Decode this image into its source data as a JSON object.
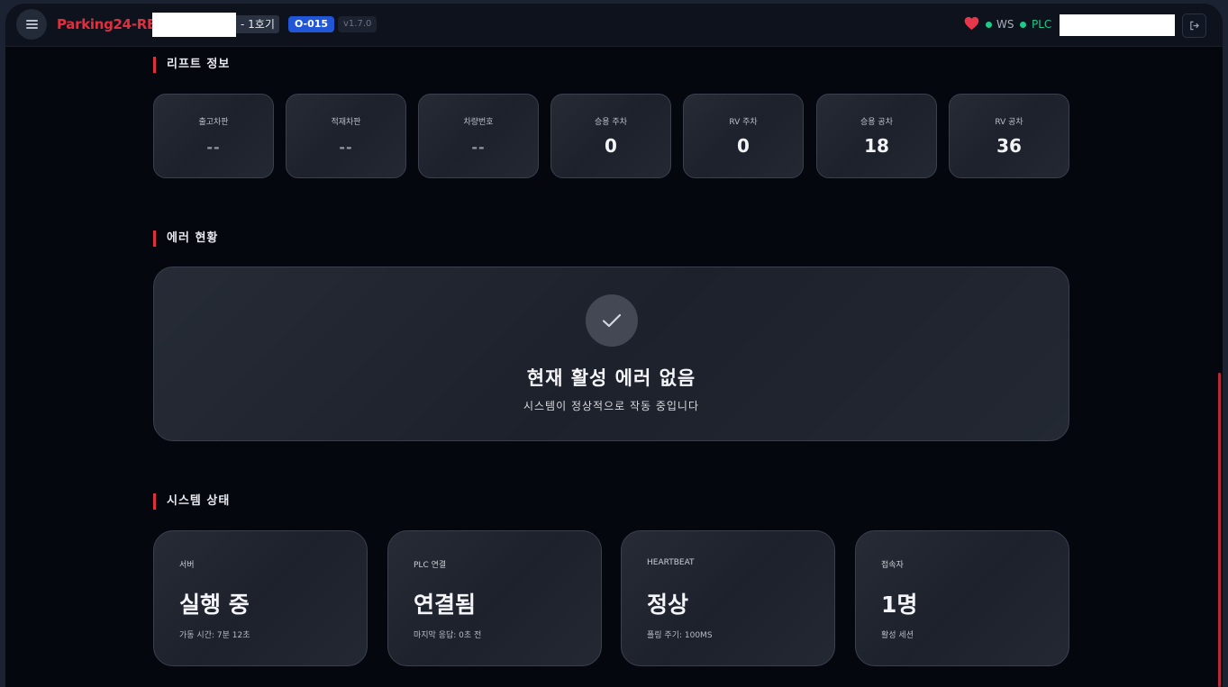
{
  "header": {
    "brand": "Parking24-RE",
    "unit_label": "- 1호기",
    "code_badge": "O-015",
    "version": "v1.7.0",
    "ws_label": "WS",
    "plc_label": "PLC"
  },
  "lift_section": {
    "title": "리프트 정보",
    "cards": [
      {
        "label": "출고차판",
        "value": "--"
      },
      {
        "label": "적재차판",
        "value": "--"
      },
      {
        "label": "차량번호",
        "value": "--"
      },
      {
        "label": "승용 주차",
        "value": "0"
      },
      {
        "label": "RV 주차",
        "value": "0"
      },
      {
        "label": "승용 공차",
        "value": "18"
      },
      {
        "label": "RV 공차",
        "value": "36"
      }
    ]
  },
  "error_section": {
    "title": "에러 현황",
    "headline": "현재 활성 에러 없음",
    "subtext": "시스템이 정상적으로 작동 중입니다"
  },
  "system_section": {
    "title": "시스템 상태",
    "cards": [
      {
        "label": "서버",
        "value": "실행 중",
        "sub": "가동 시간: 7분 12초"
      },
      {
        "label": "PLC 연결",
        "value": "연결됨",
        "sub": "마지막 응답: 0초 전"
      },
      {
        "label": "HEARTBEAT",
        "value": "정상",
        "sub": "폴링 주기: 100MS"
      },
      {
        "label": "접속자",
        "value": "1명",
        "sub": "활성 세션"
      }
    ]
  },
  "colors": {
    "accent": "#e0303f",
    "status_ok": "#1ec98b",
    "badge_blue": "#2157d6"
  },
  "icons": [
    "menu-icon",
    "heart-icon",
    "logout-icon",
    "check-icon"
  ]
}
